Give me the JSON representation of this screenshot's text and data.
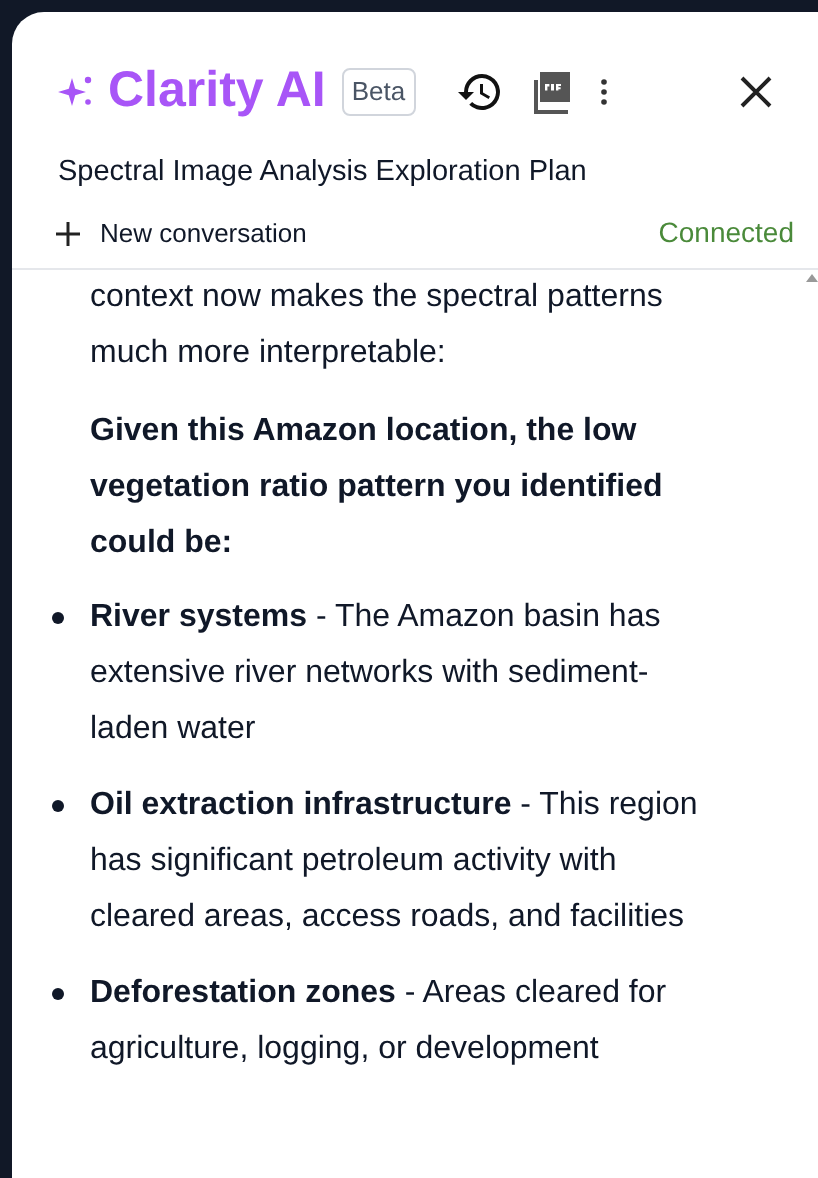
{
  "header": {
    "title": "Clarity AI",
    "badge": "Beta"
  },
  "conversation": {
    "title": "Spectral Image Analysis Exploration Plan",
    "new_label": "New conversation",
    "status": "Connected"
  },
  "message": {
    "paragraphs": [
      "context now makes the spectral patterns much more interpretable:"
    ],
    "heading": "Given this Amazon location, the low vegetation ratio pattern you identified could be:",
    "bullets": [
      {
        "term": "River systems",
        "text": " - The Amazon basin has extensive river networks with sediment-laden water"
      },
      {
        "term": "Oil extraction infrastructure",
        "text": " - This region has significant petroleum activity with cleared areas, access roads, and facilities"
      },
      {
        "term": "Deforestation zones",
        "text": " - Areas cleared for agriculture, logging, or development"
      }
    ]
  }
}
